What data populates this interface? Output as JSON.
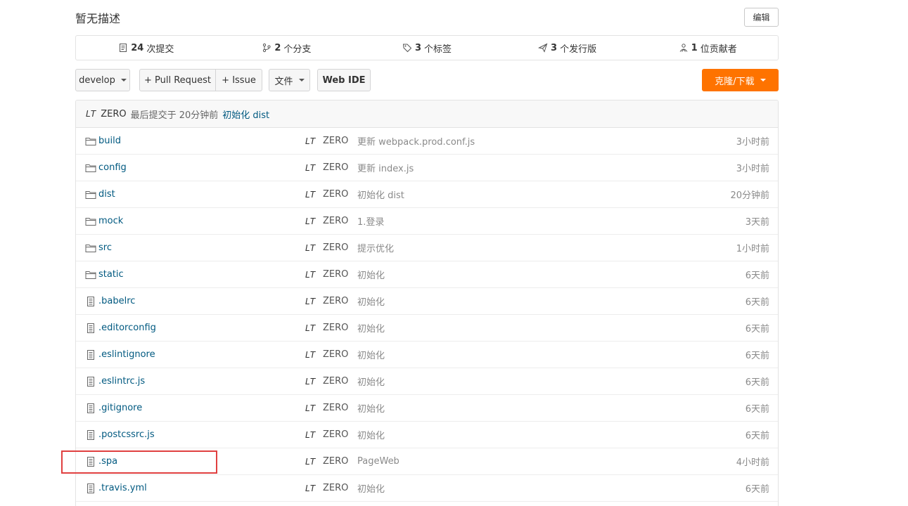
{
  "header": {
    "description": "暂无描述",
    "edit_label": "编辑"
  },
  "stats": [
    {
      "icon": "commit-icon",
      "count": "24",
      "label": "次提交"
    },
    {
      "icon": "branch-icon",
      "count": "2",
      "label": "个分支"
    },
    {
      "icon": "tag-icon",
      "count": "3",
      "label": "个标签"
    },
    {
      "icon": "release-icon",
      "count": "3",
      "label": "个发行版"
    },
    {
      "icon": "contributor-icon",
      "count": "1",
      "label": "位贡献者"
    }
  ],
  "toolbar": {
    "branch_label": "develop",
    "pull_request_label": "+ Pull Request",
    "issue_label": "+ Issue",
    "file_label": "文件",
    "web_ide_label": "Web IDE",
    "clone_label": "克隆/下载",
    "clone_color": "#fe7300"
  },
  "latest_commit": {
    "avatar": "LT",
    "author": "ZERO",
    "text": "最后提交于 20分钟前",
    "message": "初始化 dist"
  },
  "files": [
    {
      "type": "folder",
      "name": "build",
      "avatar": "LT",
      "author": "ZERO",
      "message": "更新 webpack.prod.conf.js",
      "time": "3小时前"
    },
    {
      "type": "folder",
      "name": "config",
      "avatar": "LT",
      "author": "ZERO",
      "message": "更新 index.js",
      "time": "3小时前"
    },
    {
      "type": "folder",
      "name": "dist",
      "avatar": "LT",
      "author": "ZERO",
      "message": "初始化 dist",
      "time": "20分钟前"
    },
    {
      "type": "folder",
      "name": "mock",
      "avatar": "LT",
      "author": "ZERO",
      "message": "1.登录",
      "time": "3天前"
    },
    {
      "type": "folder",
      "name": "src",
      "avatar": "LT",
      "author": "ZERO",
      "message": "提示优化",
      "time": "1小时前"
    },
    {
      "type": "folder",
      "name": "static",
      "avatar": "LT",
      "author": "ZERO",
      "message": "初始化",
      "time": "6天前"
    },
    {
      "type": "file",
      "name": ".babelrc",
      "avatar": "LT",
      "author": "ZERO",
      "message": "初始化",
      "time": "6天前"
    },
    {
      "type": "file",
      "name": ".editorconfig",
      "avatar": "LT",
      "author": "ZERO",
      "message": "初始化",
      "time": "6天前"
    },
    {
      "type": "file",
      "name": ".eslintignore",
      "avatar": "LT",
      "author": "ZERO",
      "message": "初始化",
      "time": "6天前"
    },
    {
      "type": "file",
      "name": ".eslintrc.js",
      "avatar": "LT",
      "author": "ZERO",
      "message": "初始化",
      "time": "6天前"
    },
    {
      "type": "file",
      "name": ".gitignore",
      "avatar": "LT",
      "author": "ZERO",
      "message": "初始化",
      "time": "6天前"
    },
    {
      "type": "file",
      "name": ".postcssrc.js",
      "avatar": "LT",
      "author": "ZERO",
      "message": "初始化",
      "time": "6天前"
    },
    {
      "type": "file",
      "name": ".spa",
      "avatar": "LT",
      "author": "ZERO",
      "message": "PageWeb",
      "time": "4小时前"
    },
    {
      "type": "file",
      "name": ".travis.yml",
      "avatar": "LT",
      "author": "ZERO",
      "message": "初始化",
      "time": "6天前"
    }
  ],
  "highlight_color": "#e04040"
}
